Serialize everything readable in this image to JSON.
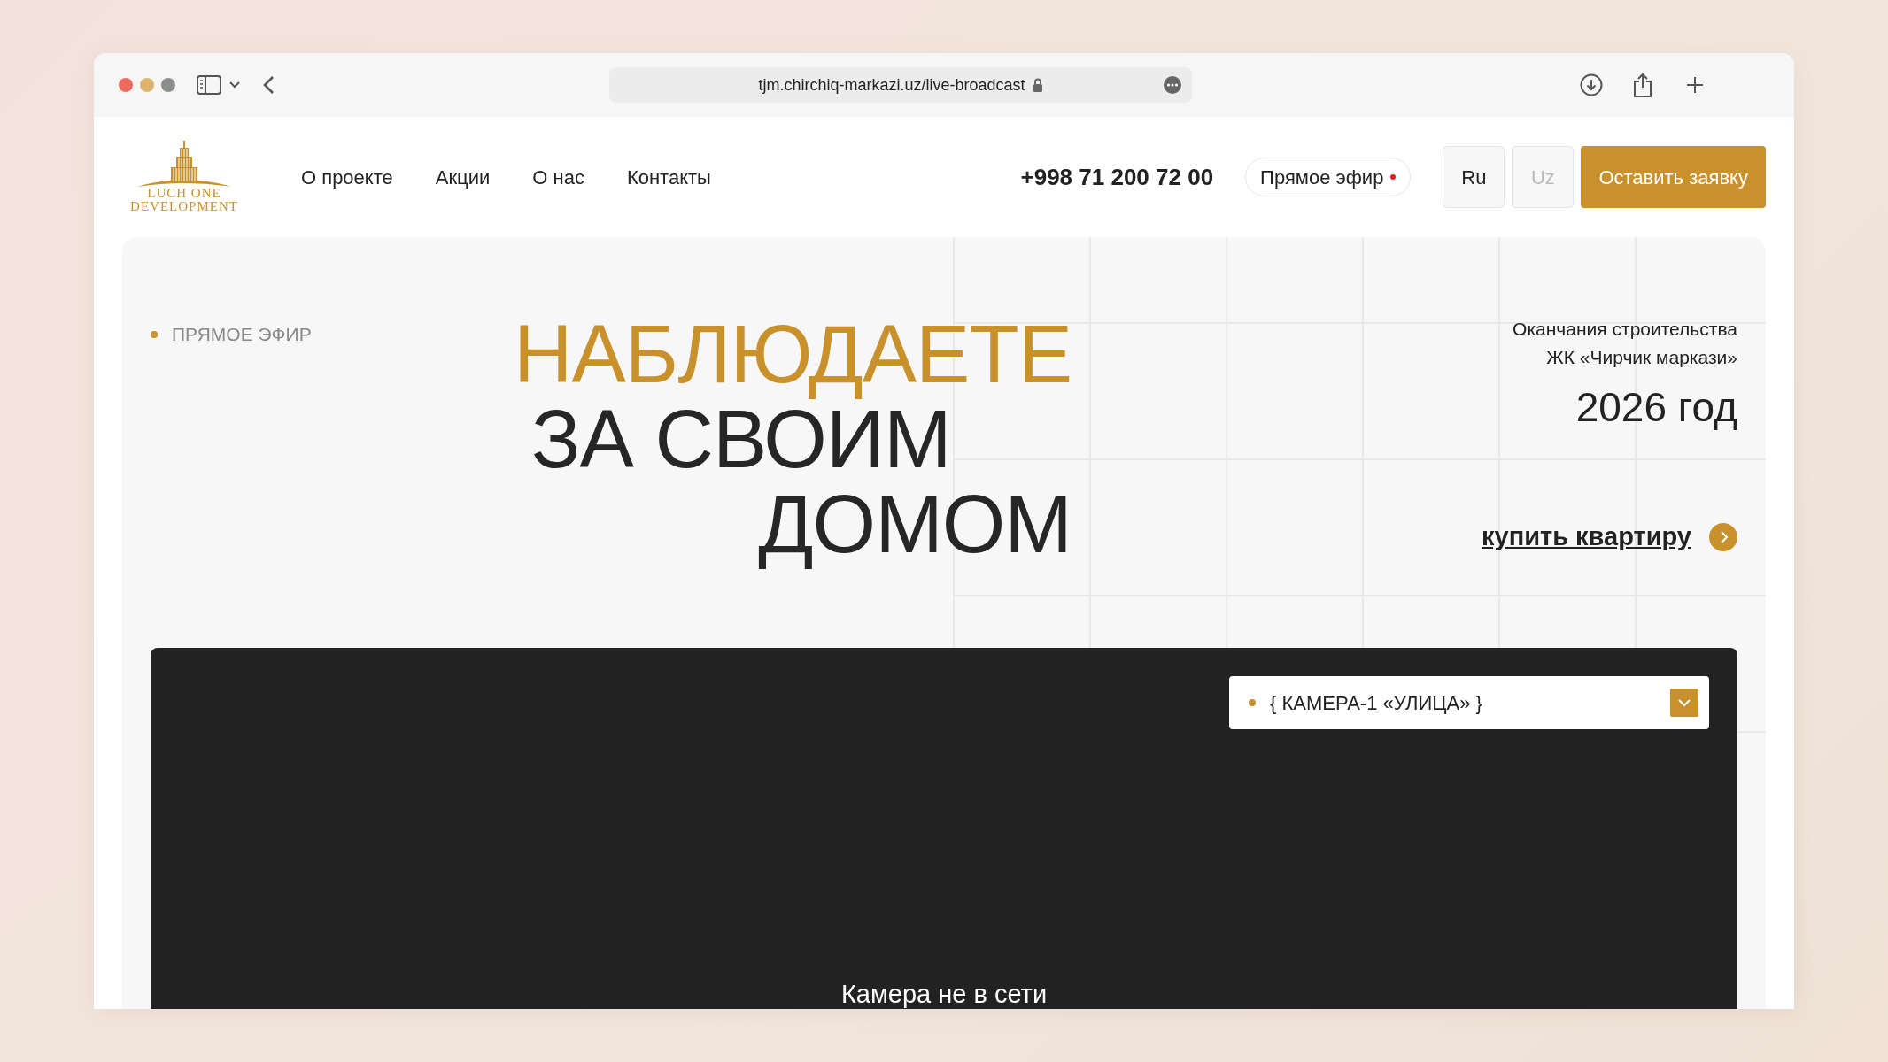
{
  "browser": {
    "url": "tjm.chirchiq-markazi.uz/live-broadcast"
  },
  "header": {
    "logo": {
      "line1": "LUCH ONE",
      "line2": "DEVELOPMENT"
    },
    "nav": [
      "О проекте",
      "Акции",
      "О нас",
      "Контакты"
    ],
    "phone": "+998 71 200 72 00",
    "live_button": {
      "label": "Прямое эфир",
      "live": true
    },
    "languages": [
      {
        "label": "Ru",
        "selected": true
      },
      {
        "label": "Uz",
        "selected": false
      }
    ],
    "cta": "Оставить заявку"
  },
  "hero": {
    "eyebrow": "ПРЯМОЕ ЭФИР",
    "headline": [
      {
        "text": "НАБЛЮДАЕТЕ",
        "kind": "accent"
      },
      {
        "text": "ЗА СВОИМ",
        "kind": "plain"
      },
      {
        "text": "ДОМОМ",
        "kind": "plain"
      }
    ],
    "completion": {
      "lines": [
        "Оканчания строительства",
        "ЖК «Чирчик маркази»"
      ],
      "year": "2026 год"
    },
    "buy_link": "купить квартиру"
  },
  "video": {
    "camera_select": {
      "value": "{ КАМЕРА-1 «УЛИЦА» }"
    },
    "status": "Камера не в сети"
  }
}
